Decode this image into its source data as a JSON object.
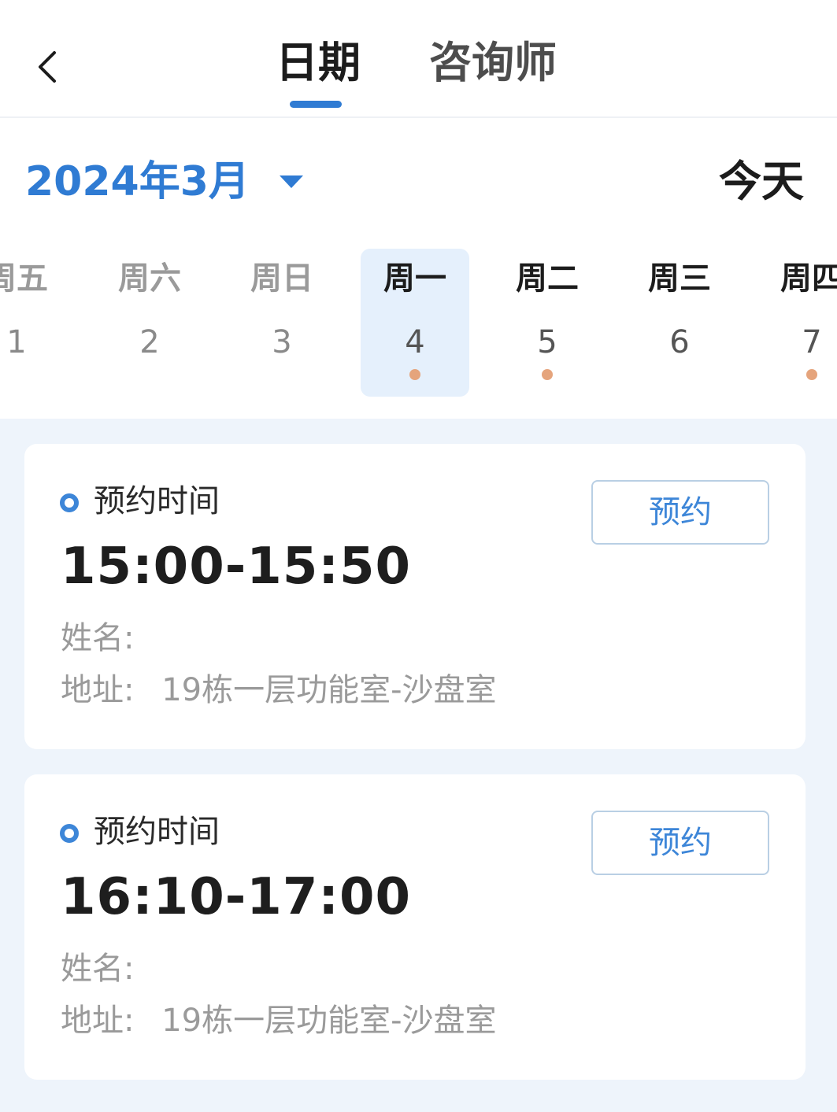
{
  "header": {
    "tabs": [
      {
        "label": "日期",
        "active": true
      },
      {
        "label": "咨询师",
        "active": false
      }
    ]
  },
  "calendar": {
    "month": "2024年3月",
    "today_label": "今天",
    "days": [
      {
        "weekday": "周五",
        "date": "1",
        "state": "past",
        "has_slots": false
      },
      {
        "weekday": "周六",
        "date": "2",
        "state": "past",
        "has_slots": false
      },
      {
        "weekday": "周日",
        "date": "3",
        "state": "past",
        "has_slots": false
      },
      {
        "weekday": "周一",
        "date": "4",
        "state": "selected",
        "has_slots": true
      },
      {
        "weekday": "周二",
        "date": "5",
        "state": "future",
        "has_slots": true
      },
      {
        "weekday": "周三",
        "date": "6",
        "state": "future",
        "has_slots": false
      },
      {
        "weekday": "周四",
        "date": "7",
        "state": "future",
        "has_slots": true
      }
    ]
  },
  "slots": [
    {
      "heading": "预约时间",
      "time": "15:00-15:50",
      "name_label": "姓名:",
      "address_label": "地址:",
      "address": "19栋一层功能室-沙盘室",
      "button_label": "预约"
    },
    {
      "heading": "预约时间",
      "time": "16:10-17:00",
      "name_label": "姓名:",
      "address_label": "地址:",
      "address": "19栋一层功能室-沙盘室",
      "button_label": "预约"
    }
  ],
  "colors": {
    "accent": "#2f7bd3",
    "dot": "#e5a47c",
    "list_background": "#eef4fb",
    "selected_day_background": "#e5f0fc"
  },
  "icons": {
    "back": "chevron-left-icon",
    "month_dropdown": "caret-down-icon",
    "slot_marker": "ring-icon"
  }
}
